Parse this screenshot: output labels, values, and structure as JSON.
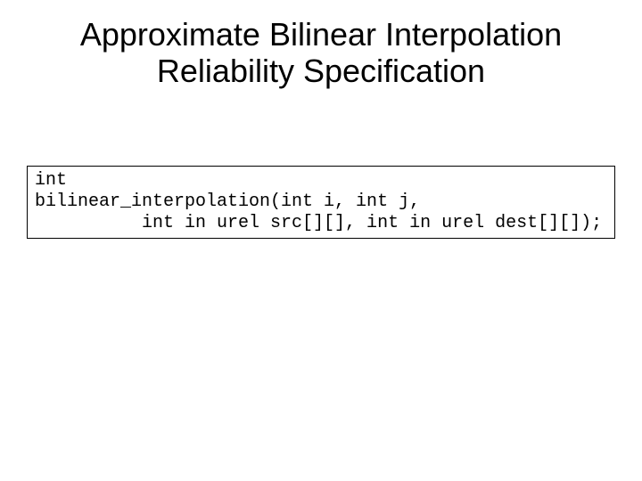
{
  "title_line1": "Approximate Bilinear Interpolation",
  "title_line2": "Reliability Specification",
  "code_line1": "int",
  "code_line2": "bilinear_interpolation(int i, int j,",
  "code_line3": "          int in urel src[][], int in urel dest[][]);"
}
